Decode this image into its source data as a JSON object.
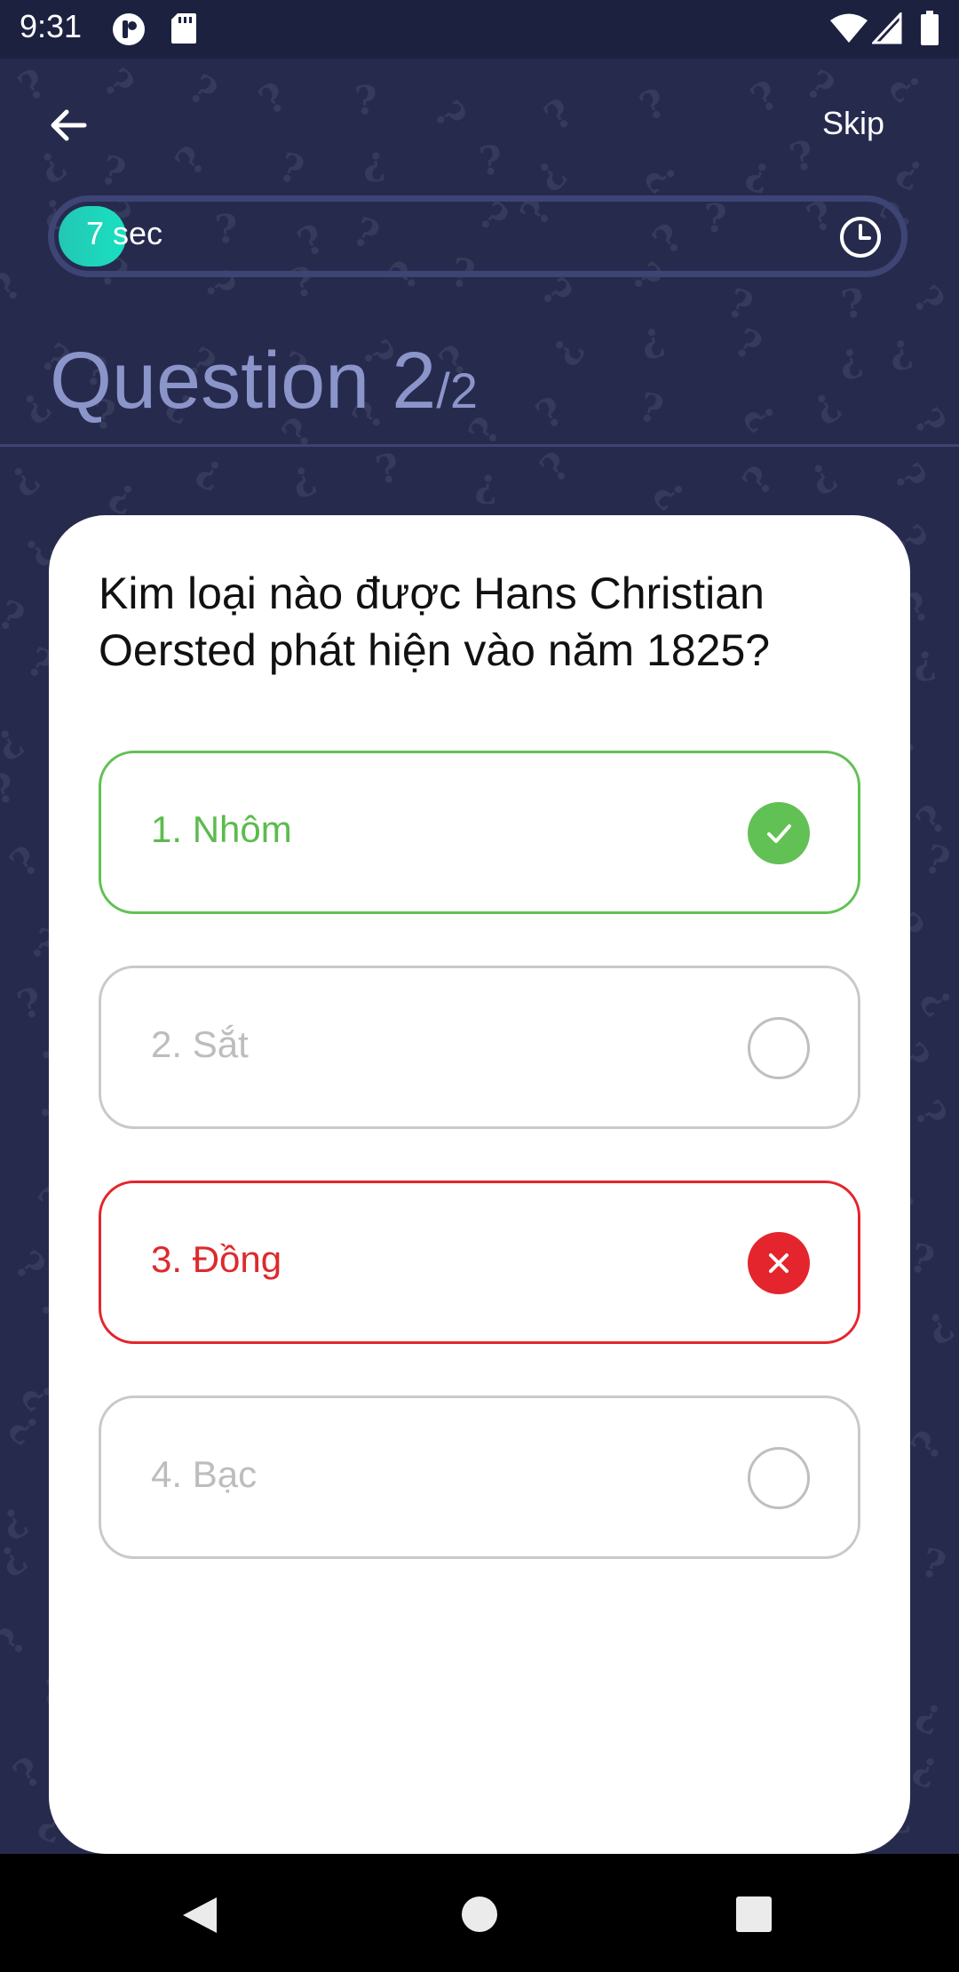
{
  "status_bar": {
    "time": "9:31",
    "icons": [
      "app-notification-icon",
      "sd-card-icon",
      "wifi-icon",
      "signal-icon",
      "battery-icon"
    ]
  },
  "top_bar": {
    "back_icon": "arrow-left-icon",
    "skip_label": "Skip"
  },
  "timer": {
    "label": "7 sec",
    "progress": 0.08,
    "icon": "clock-icon",
    "fill_color": "#1fd6bd"
  },
  "header": {
    "question_word": "Question 2",
    "question_total": "/2"
  },
  "card": {
    "question": "Kim loại nào được Hans Christian Oersted phát hiện vào năm 1825?",
    "options": [
      {
        "label": "1. Nhôm",
        "state": "correct",
        "icon": "check-icon"
      },
      {
        "label": "2. Sắt",
        "state": "neutral",
        "icon": "radio-empty-icon"
      },
      {
        "label": "3. Đồng",
        "state": "wrong",
        "icon": "close-icon"
      },
      {
        "label": "4. Bạc",
        "state": "neutral",
        "icon": "radio-empty-icon"
      }
    ]
  },
  "colors": {
    "background": "#262b4e",
    "correct": "#62c154",
    "wrong": "#e5252d",
    "header_text": "#8b95c9"
  },
  "nav_bar": {
    "icons": [
      "nav-back-icon",
      "nav-home-icon",
      "nav-recents-icon"
    ]
  }
}
